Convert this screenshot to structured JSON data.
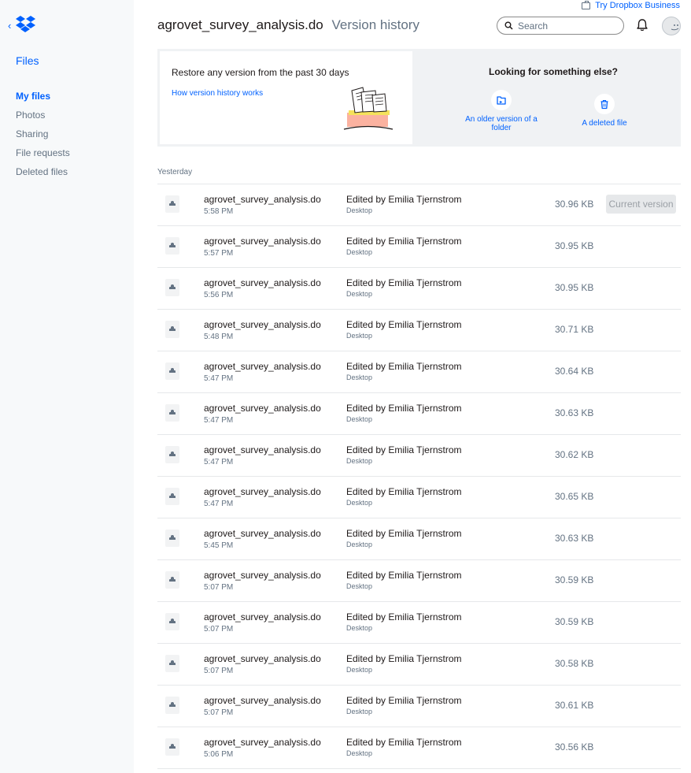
{
  "top": {
    "try_business": "Try Dropbox Business"
  },
  "sidebar": {
    "back": "‹",
    "section_title": "Files",
    "items": [
      {
        "label": "My files",
        "active": true
      },
      {
        "label": "Photos",
        "active": false
      },
      {
        "label": "Sharing",
        "active": false
      },
      {
        "label": "File requests",
        "active": false
      },
      {
        "label": "Deleted files",
        "active": false
      }
    ]
  },
  "header": {
    "filename": "agrovet_survey_analysis.do",
    "subtitle": "Version history",
    "search_placeholder": "Search"
  },
  "banner": {
    "restore_text": "Restore any version from the past 30 days",
    "how_link": "How version history works",
    "alt_title": "Looking for something else?",
    "older_folder": "An older version of a folder",
    "deleted_file": "A deleted file"
  },
  "section_label": "Yesterday",
  "current_version_label": "Current version",
  "versions": [
    {
      "name": "agrovet_survey_analysis.do",
      "time": "5:58 PM",
      "edited": "Edited by Emilia Tjernstrom",
      "source": "Desktop",
      "size": "30.96 KB",
      "current": true
    },
    {
      "name": "agrovet_survey_analysis.do",
      "time": "5:57 PM",
      "edited": "Edited by Emilia Tjernstrom",
      "source": "Desktop",
      "size": "30.95 KB",
      "current": false
    },
    {
      "name": "agrovet_survey_analysis.do",
      "time": "5:56 PM",
      "edited": "Edited by Emilia Tjernstrom",
      "source": "Desktop",
      "size": "30.95 KB",
      "current": false
    },
    {
      "name": "agrovet_survey_analysis.do",
      "time": "5:48 PM",
      "edited": "Edited by Emilia Tjernstrom",
      "source": "Desktop",
      "size": "30.71 KB",
      "current": false
    },
    {
      "name": "agrovet_survey_analysis.do",
      "time": "5:47 PM",
      "edited": "Edited by Emilia Tjernstrom",
      "source": "Desktop",
      "size": "30.64 KB",
      "current": false
    },
    {
      "name": "agrovet_survey_analysis.do",
      "time": "5:47 PM",
      "edited": "Edited by Emilia Tjernstrom",
      "source": "Desktop",
      "size": "30.63 KB",
      "current": false
    },
    {
      "name": "agrovet_survey_analysis.do",
      "time": "5:47 PM",
      "edited": "Edited by Emilia Tjernstrom",
      "source": "Desktop",
      "size": "30.62 KB",
      "current": false
    },
    {
      "name": "agrovet_survey_analysis.do",
      "time": "5:47 PM",
      "edited": "Edited by Emilia Tjernstrom",
      "source": "Desktop",
      "size": "30.65 KB",
      "current": false
    },
    {
      "name": "agrovet_survey_analysis.do",
      "time": "5:45 PM",
      "edited": "Edited by Emilia Tjernstrom",
      "source": "Desktop",
      "size": "30.63 KB",
      "current": false
    },
    {
      "name": "agrovet_survey_analysis.do",
      "time": "5:07 PM",
      "edited": "Edited by Emilia Tjernstrom",
      "source": "Desktop",
      "size": "30.59 KB",
      "current": false
    },
    {
      "name": "agrovet_survey_analysis.do",
      "time": "5:07 PM",
      "edited": "Edited by Emilia Tjernstrom",
      "source": "Desktop",
      "size": "30.59 KB",
      "current": false
    },
    {
      "name": "agrovet_survey_analysis.do",
      "time": "5:07 PM",
      "edited": "Edited by Emilia Tjernstrom",
      "source": "Desktop",
      "size": "30.58 KB",
      "current": false
    },
    {
      "name": "agrovet_survey_analysis.do",
      "time": "5:07 PM",
      "edited": "Edited by Emilia Tjernstrom",
      "source": "Desktop",
      "size": "30.61 KB",
      "current": false
    },
    {
      "name": "agrovet_survey_analysis.do",
      "time": "5:06 PM",
      "edited": "Edited by Emilia Tjernstrom",
      "source": "Desktop",
      "size": "30.56 KB",
      "current": false
    }
  ],
  "icons": {
    "logo": "dropbox-logo-icon",
    "search": "search-icon",
    "bell": "bell-icon",
    "file": "file-icon",
    "folder_restore": "folder-restore-icon",
    "trash": "trash-icon"
  },
  "colors": {
    "accent": "#0061fe",
    "sidebar_bg": "#f7f9fa",
    "muted": "#637282",
    "banner_bg": "#f0f2f4"
  }
}
